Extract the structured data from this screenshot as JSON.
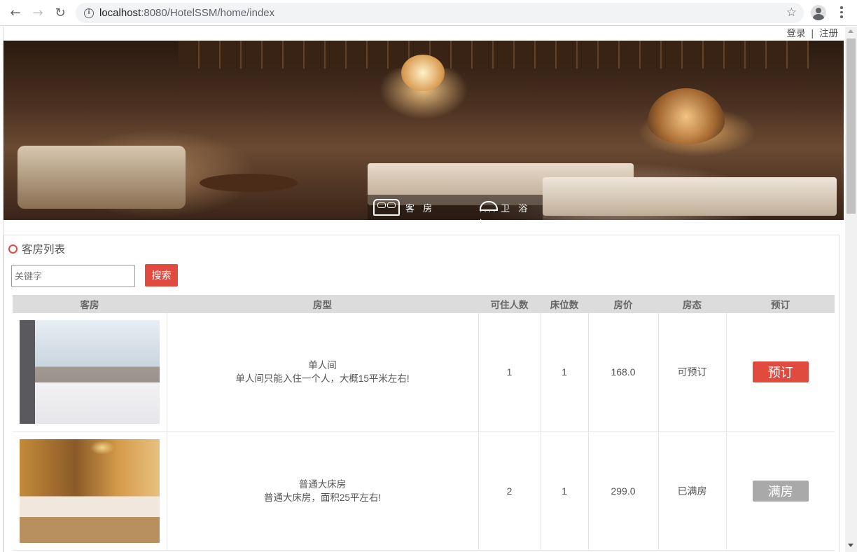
{
  "browser": {
    "url_host": "localhost",
    "url_rest": ":8080/HotelSSM/home/index"
  },
  "topbar": {
    "login": "登录",
    "separator": "|",
    "register": "注册"
  },
  "banner": {
    "nav": [
      {
        "label": "客 房",
        "icon": "bed-icon"
      },
      {
        "label": "卫 浴",
        "icon": "shower-icon"
      }
    ]
  },
  "room_list": {
    "title": "客房列表",
    "search_placeholder": "关键字",
    "search_button": "搜索",
    "columns": [
      "客房",
      "房型",
      "可住人数",
      "床位数",
      "房价",
      "房态",
      "预订"
    ],
    "rows": [
      {
        "image": "single-room-photo",
        "type_name": "单人间",
        "type_desc": "单人间只能入住一个人，大概15平米左右!",
        "capacity": "1",
        "beds": "1",
        "price": "168.0",
        "status": "可预订",
        "action": "预订",
        "action_color": "#e04a3f"
      },
      {
        "image": "double-room-photo",
        "type_name": "普通大床房",
        "type_desc": "普通大床房，面积25平左右!",
        "capacity": "2",
        "beds": "1",
        "price": "299.0",
        "status": "已满房",
        "action": "满房",
        "action_color": "#a9a9a9"
      }
    ]
  },
  "colors": {
    "accent": "#e04a3f",
    "disabled": "#a9a9a9",
    "header_bg": "#dcdcdc"
  }
}
